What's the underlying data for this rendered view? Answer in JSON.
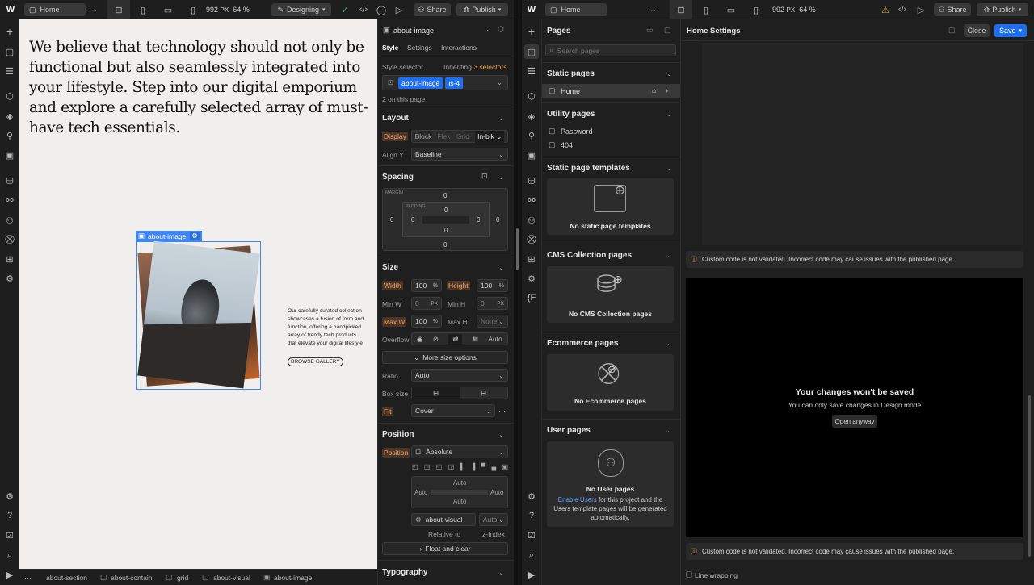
{
  "left_topbar": {
    "page_tab": "Home",
    "width_value": "992",
    "width_unit": "PX",
    "zoom": "64 %",
    "mode": "Designing",
    "share": "Share",
    "publish": "Publish"
  },
  "canvas": {
    "headline": "We believe that technology should not only be functional but also seamlessly integrated into your lifestyle. Step into our digital emporium and explore a carefully selected array of must-have tech essentials.",
    "selection_label": "about-image",
    "body_text": "Our carefully curated collection showcases a fusion of form and function, offering a handpicked array of trendy tech products that elevate your digital lifestyle",
    "gallery_button": "BROWSE GALLERY"
  },
  "breadcrumb": [
    "about-section",
    "about-contain",
    "grid",
    "about-visual",
    "about-image"
  ],
  "style_panel": {
    "element_name": "about-image",
    "tabs": [
      "Style",
      "Settings",
      "Interactions"
    ],
    "style_selector_label": "Style selector",
    "inheriting_prefix": "Inheriting",
    "inheriting_count": "3 selectors",
    "class_1": "about-image",
    "class_2": "is-4",
    "on_page": "2 on this page",
    "layout": {
      "title": "Layout",
      "display_label": "Display",
      "display_options": [
        "Block",
        "Flex",
        "Grid",
        "In-blk"
      ],
      "align_label": "Align Y",
      "align_value": "Baseline"
    },
    "spacing": {
      "title": "Spacing",
      "margin_label": "MARGIN",
      "padding_label": "PADDING",
      "margin_top": "0",
      "margin_right": "0",
      "margin_bottom": "0",
      "margin_left": "0",
      "padding_top": "0",
      "padding_right": "0",
      "padding_bottom": "0",
      "padding_left": "0"
    },
    "size": {
      "title": "Size",
      "width_label": "Width",
      "width_value": "100",
      "width_unit": "%",
      "height_label": "Height",
      "height_value": "100",
      "height_unit": "%",
      "minw_label": "Min W",
      "minw_value": "0",
      "minw_unit": "PX",
      "minh_label": "Min H",
      "minh_value": "0",
      "minh_unit": "PX",
      "maxw_label": "Max W",
      "maxw_value": "100",
      "maxw_unit": "%",
      "maxh_label": "Max H",
      "maxh_value": "None",
      "overflow_label": "Overflow",
      "overflow_auto": "Auto",
      "more_options": "More size options",
      "ratio_label": "Ratio",
      "ratio_value": "Auto",
      "boxsize_label": "Box size",
      "fit_label": "Fit",
      "fit_value": "Cover"
    },
    "position": {
      "title": "Position",
      "position_label": "Position",
      "position_value": "Absolute",
      "top": "Auto",
      "left": "Auto",
      "right": "Auto",
      "bottom": "Auto",
      "relative_value": "about-visual",
      "zindex_value": "Auto",
      "relative_label": "Relative to",
      "zindex_label": "z-Index",
      "float_clear": "Float and clear"
    },
    "typography_title": "Typography"
  },
  "right_topbar": {
    "page_tab": "Home",
    "width_value": "992",
    "width_unit": "PX",
    "zoom": "64 %",
    "share": "Share",
    "publish": "Publish"
  },
  "pages_panel": {
    "title": "Pages",
    "search_placeholder": "Search pages",
    "static_title": "Static pages",
    "static_items": [
      "Home"
    ],
    "utility_title": "Utility pages",
    "utility_items": [
      "Password",
      "404"
    ],
    "templates_title": "Static page templates",
    "templates_empty": "No static page templates",
    "cms_title": "CMS Collection pages",
    "cms_empty": "No CMS Collection pages",
    "ecom_title": "Ecommerce pages",
    "ecom_empty": "No Ecommerce pages",
    "user_title": "User pages",
    "user_empty": "No User pages",
    "user_link": "Enable Users",
    "user_desc": "for this project and the Users template pages will be generated automatically."
  },
  "settings_panel": {
    "title": "Home Settings",
    "close": "Close",
    "save": "Save",
    "warning": "Custom code is not validated. Incorrect code may cause issues with the published page.",
    "overlay_title": "Your changes won't be saved",
    "overlay_sub": "You can only save changes in Design mode",
    "open_anyway": "Open anyway",
    "line_wrapping": "Line wrapping"
  },
  "colors": {
    "accent": "#1e6ff0",
    "warning": "#e0b040",
    "selection": "#3f86f4"
  }
}
